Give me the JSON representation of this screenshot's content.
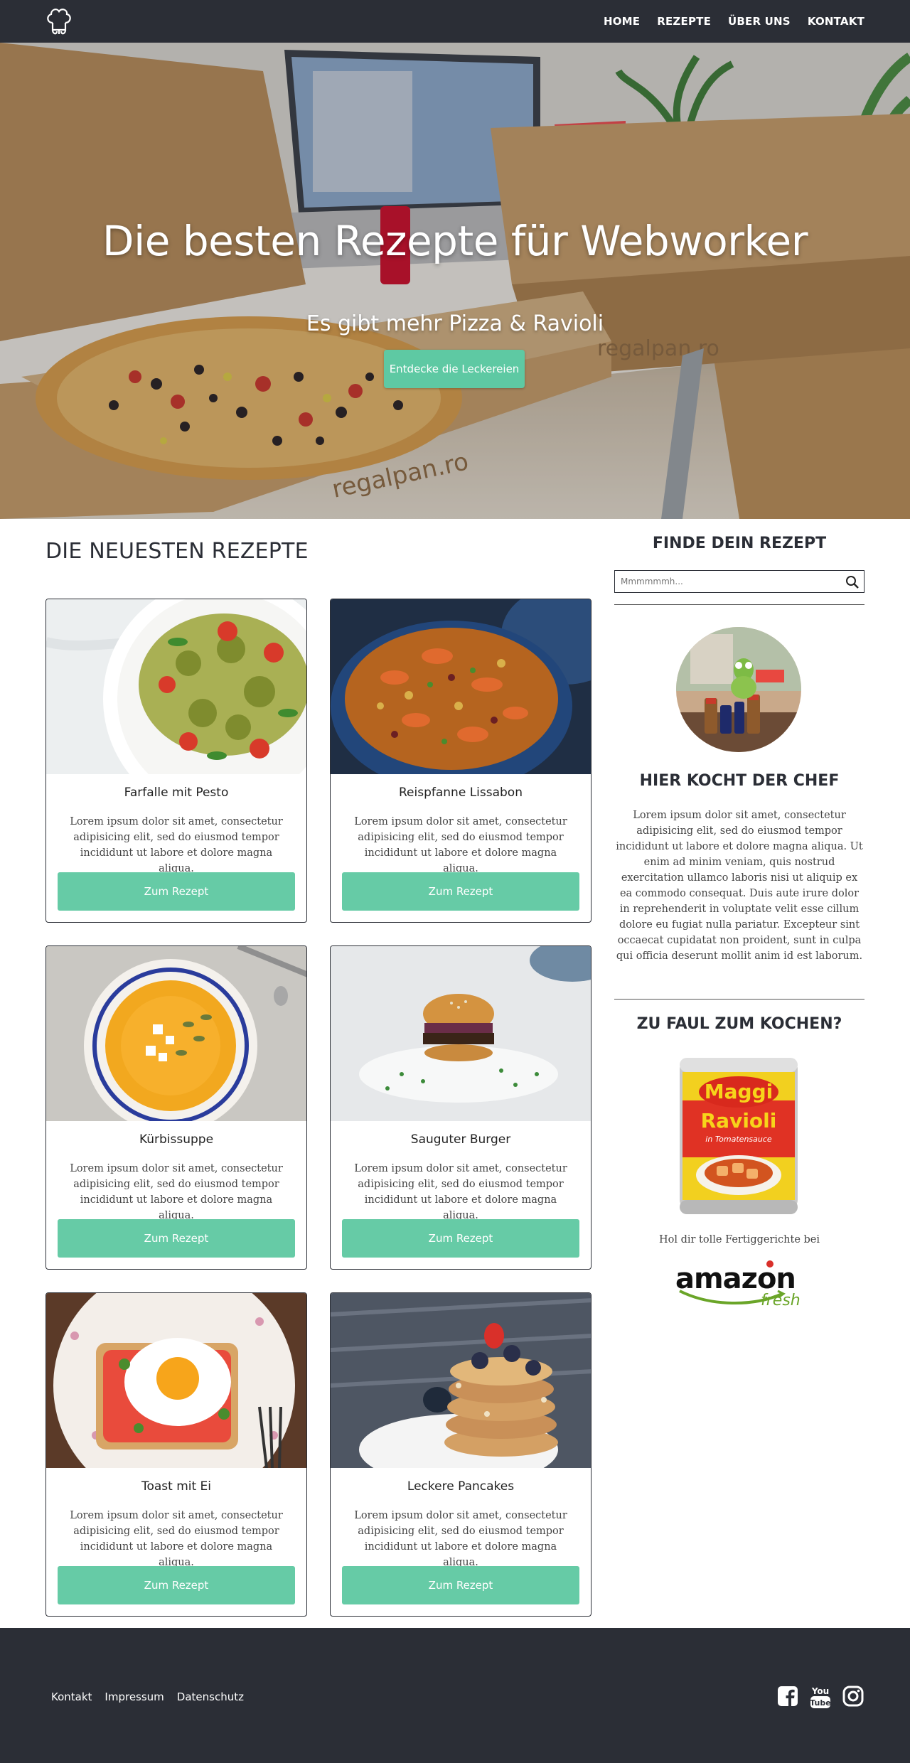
{
  "nav": {
    "logo_icon": "chef-hat-icon",
    "items": [
      {
        "label": "HOME"
      },
      {
        "label": "REZEPTE"
      },
      {
        "label": "ÜBER UNS"
      },
      {
        "label": "KONTAKT"
      }
    ]
  },
  "hero": {
    "title": "Die besten Rezepte für Webworker",
    "subtitle": "Es gibt mehr Pizza & Ravioli",
    "cta_label": "Entdecke die Leckereien",
    "accent": "#5ec9a3"
  },
  "recipes": {
    "heading": "DIE NEUESTEN REZEPTE",
    "button_label": "Zum Rezept",
    "items": [
      {
        "title": "Farfalle mit Pesto",
        "text": "Lorem ipsum dolor sit amet, consectetur adipisicing elit, sed do eiusmod tempor incididunt ut labore et dolore magna aliqua."
      },
      {
        "title": "Reispfanne Lissabon",
        "text": "Lorem ipsum dolor sit amet, consectetur adipisicing elit, sed do eiusmod tempor incididunt ut labore et dolore magna aliqua."
      },
      {
        "title": "Kürbissuppe",
        "text": "Lorem ipsum dolor sit amet, consectetur adipisicing elit, sed do eiusmod tempor incididunt ut labore et dolore magna aliqua."
      },
      {
        "title": "Sauguter Burger",
        "text": "Lorem ipsum dolor sit amet, consectetur adipisicing elit, sed do eiusmod tempor incididunt ut labore et dolore magna aliqua."
      },
      {
        "title": "Toast mit Ei",
        "text": "Lorem ipsum dolor sit amet, consectetur adipisicing elit, sed do eiusmod tempor incididunt ut labore et dolore magna aliqua."
      },
      {
        "title": "Leckere Pancakes",
        "text": "Lorem ipsum dolor sit amet, consectetur adipisicing elit, sed do eiusmod tempor incididunt ut labore et dolore magna aliqua."
      }
    ]
  },
  "sidebar": {
    "search_heading": "FINDE DEIN REZEPT",
    "search_placeholder": "Mmmmmmh...",
    "search_icon": "search-icon",
    "chef_heading": "HIER KOCHT DER CHEF",
    "chef_text": "Lorem ipsum dolor sit amet, consectetur adipisicing elit, sed do eiusmod tempor incididunt ut labore et dolore magna aliqua. Ut enim ad minim veniam, quis nostrud exercitation ullamco laboris nisi ut aliquip ex ea commodo consequat. Duis aute irure dolor in reprehenderit in voluptate velit esse cillum dolore eu fugiat nulla pariatur. Excepteur sint occaecat cupidatat non proident, sunt in culpa qui officia deserunt mollit anim id est laborum.",
    "lazy_heading": "ZU FAUL ZUM KOCHEN?",
    "can_brand": "Maggi",
    "can_product": "Ravioli",
    "can_sub": "in Tomatensauce",
    "ad_text": "Hol dir tolle Fertiggerichte bei",
    "ad_logo_text": "amazon",
    "ad_logo_sub": "fresh"
  },
  "footer": {
    "links": [
      {
        "label": "Kontakt"
      },
      {
        "label": "Impressum"
      },
      {
        "label": "Datenschutz"
      }
    ],
    "social": [
      "facebook-icon",
      "youtube-icon",
      "instagram-icon"
    ],
    "youtube_you": "You",
    "youtube_tube": "Tube"
  },
  "colors": {
    "dark": "#2b2e36",
    "accent": "#66cba6"
  }
}
